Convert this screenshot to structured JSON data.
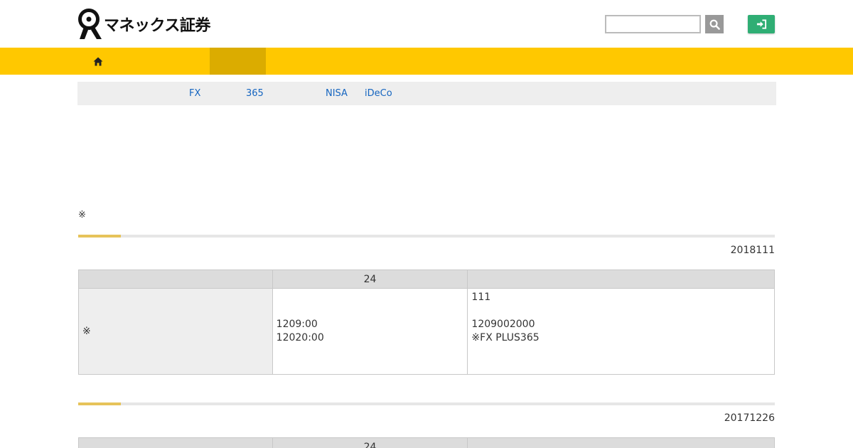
{
  "header": {
    "logo_text": "マネックス証券",
    "search": {
      "value": "",
      "placeholder": ""
    },
    "icons": {
      "search": "search-icon",
      "login": "sign-in-icon",
      "home": "home-icon"
    },
    "colors": {
      "nav_bar": "#ffc800",
      "nav_active": "#dbac00",
      "login_button": "#2fae74",
      "link": "#1565c0",
      "accent": "#e6c35a"
    }
  },
  "subnav": {
    "items": [
      {
        "label": "FX"
      },
      {
        "label": "365"
      },
      {
        "label": "NISA"
      },
      {
        "label": "iDeCo"
      }
    ]
  },
  "main": {
    "note_mark": "※",
    "sections": [
      {
        "date": "2018111",
        "table": {
          "headers": [
            "",
            "24",
            ""
          ],
          "row_label": "※",
          "col2_line1": "1209:00",
          "col2_line2": "12020:00",
          "col3_line1": "111",
          "col3_line2": "1209002000",
          "col3_line3": "※FX PLUS365"
        }
      },
      {
        "date": "20171226",
        "table": {
          "headers": [
            "",
            "24",
            ""
          ]
        }
      }
    ]
  }
}
